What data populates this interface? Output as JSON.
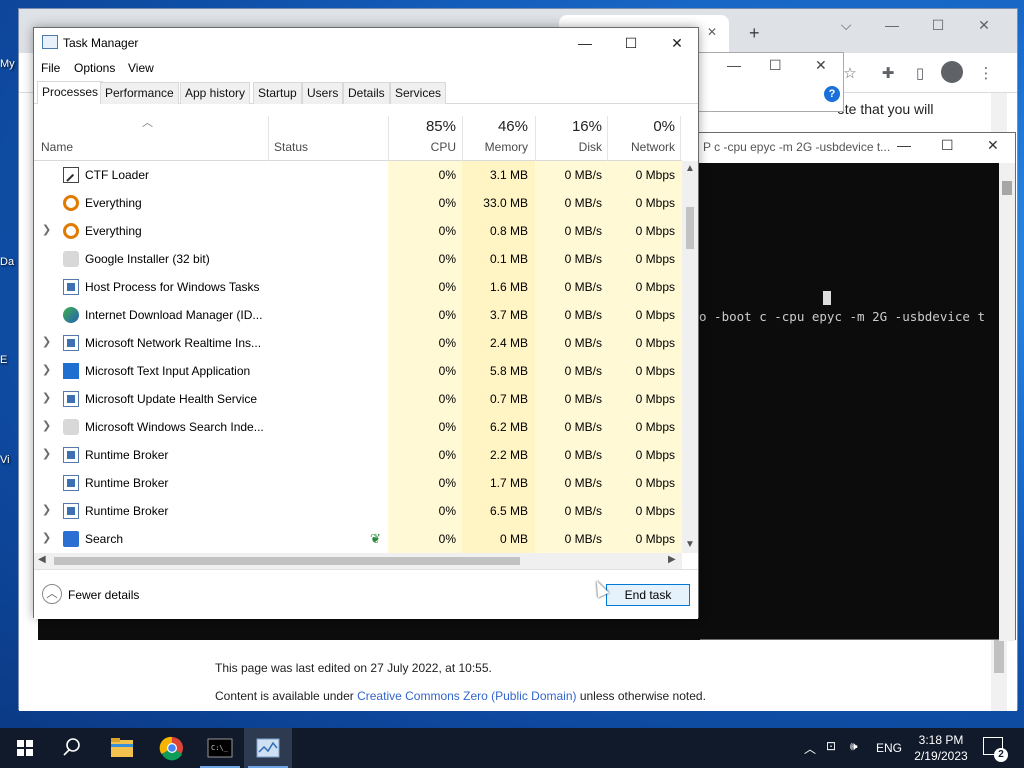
{
  "desktop": {
    "labels": [
      "My",
      "Da",
      "E",
      "Vi"
    ]
  },
  "browser": {
    "page_snippet": "ote that you will",
    "footer_edited": "This page was last edited on 27 July 2022, at 10:55.",
    "footer_content_prefix": "Content is available under ",
    "footer_license_link": "Creative Commons Zero (Public Domain)",
    "footer_content_suffix": " unless otherwise noted."
  },
  "console": {
    "title": "P c -cpu epyc -m 2G -usbdevice t...",
    "text": "o -boot c -cpu epyc -m 2G -usbdevice t"
  },
  "taskmanager": {
    "title": "Task Manager",
    "menu": [
      "File",
      "Options",
      "View"
    ],
    "tabs": [
      "Processes",
      "Performance",
      "App history",
      "Startup",
      "Users",
      "Details",
      "Services"
    ],
    "active_tab": "Processes",
    "columns": {
      "name": "Name",
      "status": "Status",
      "cpu": {
        "pct": "85%",
        "label": "CPU"
      },
      "memory": {
        "pct": "46%",
        "label": "Memory"
      },
      "disk": {
        "pct": "16%",
        "label": "Disk"
      },
      "network": {
        "pct": "0%",
        "label": "Network"
      }
    },
    "rows": [
      {
        "name": "CTF Loader",
        "icon": "ctf-icon",
        "expandable": false,
        "cpu": "0%",
        "memory": "3.1 MB",
        "disk": "0 MB/s",
        "network": "0 Mbps"
      },
      {
        "name": "Everything",
        "icon": "everything-icon",
        "expandable": false,
        "cpu": "0%",
        "memory": "33.0 MB",
        "disk": "0 MB/s",
        "network": "0 Mbps"
      },
      {
        "name": "Everything",
        "icon": "everything-icon",
        "expandable": true,
        "cpu": "0%",
        "memory": "0.8 MB",
        "disk": "0 MB/s",
        "network": "0 Mbps"
      },
      {
        "name": "Google Installer (32 bit)",
        "icon": "google-installer-icon",
        "expandable": false,
        "cpu": "0%",
        "memory": "0.1 MB",
        "disk": "0 MB/s",
        "network": "0 Mbps"
      },
      {
        "name": "Host Process for Windows Tasks",
        "icon": "host-process-icon",
        "expandable": false,
        "cpu": "0%",
        "memory": "1.6 MB",
        "disk": "0 MB/s",
        "network": "0 Mbps"
      },
      {
        "name": "Internet Download Manager (ID...",
        "icon": "idm-icon",
        "expandable": false,
        "cpu": "0%",
        "memory": "3.7 MB",
        "disk": "0 MB/s",
        "network": "0 Mbps"
      },
      {
        "name": "Microsoft Network Realtime Ins...",
        "icon": "service-icon",
        "expandable": true,
        "cpu": "0%",
        "memory": "2.4 MB",
        "disk": "0 MB/s",
        "network": "0 Mbps"
      },
      {
        "name": "Microsoft Text Input Application",
        "icon": "text-input-icon",
        "expandable": true,
        "cpu": "0%",
        "memory": "5.8 MB",
        "disk": "0 MB/s",
        "network": "0 Mbps"
      },
      {
        "name": "Microsoft Update Health Service",
        "icon": "service-icon",
        "expandable": true,
        "cpu": "0%",
        "memory": "0.7 MB",
        "disk": "0 MB/s",
        "network": "0 Mbps"
      },
      {
        "name": "Microsoft Windows Search Inde...",
        "icon": "search-indexer-icon",
        "expandable": true,
        "cpu": "0%",
        "memory": "6.2 MB",
        "disk": "0 MB/s",
        "network": "0 Mbps"
      },
      {
        "name": "Runtime Broker",
        "icon": "service-icon",
        "expandable": true,
        "cpu": "0%",
        "memory": "2.2 MB",
        "disk": "0 MB/s",
        "network": "0 Mbps"
      },
      {
        "name": "Runtime Broker",
        "icon": "service-icon",
        "expandable": false,
        "cpu": "0%",
        "memory": "1.7 MB",
        "disk": "0 MB/s",
        "network": "0 Mbps"
      },
      {
        "name": "Runtime Broker",
        "icon": "service-icon",
        "expandable": true,
        "cpu": "0%",
        "memory": "6.5 MB",
        "disk": "0 MB/s",
        "network": "0 Mbps"
      },
      {
        "name": "Search",
        "icon": "search-app-icon",
        "expandable": true,
        "suspended": true,
        "cpu": "0%",
        "memory": "0 MB",
        "disk": "0 MB/s",
        "network": "0 Mbps"
      }
    ],
    "fewer_details": "Fewer details",
    "end_task": "End task"
  },
  "taskbar": {
    "pinned": [
      "start-button",
      "search-button",
      "file-explorer",
      "chrome",
      "command-prompt",
      "task-manager"
    ],
    "language": "ENG",
    "time": "3:18 PM",
    "date": "2/19/2023",
    "notification_count": "2"
  },
  "colors": {
    "accent": "#0078d7",
    "heat_light": "#fff9d6",
    "heat_mid": "#fff4c4",
    "taskbar": "#101a2a"
  }
}
